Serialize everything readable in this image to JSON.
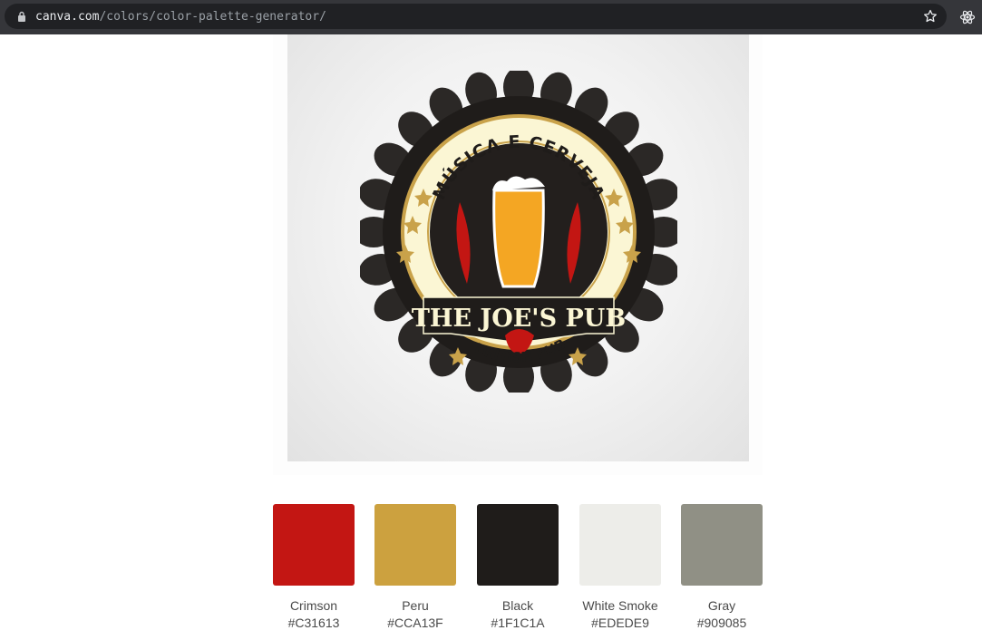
{
  "browser": {
    "url_domain": "canva.com",
    "url_path": "/colors/color-palette-generator/"
  },
  "icons": {
    "lock": "lock-icon",
    "bookmark": "star-icon",
    "extension": "atom-extension-icon"
  },
  "logo": {
    "top_text": "MÚSICA E CERVEJA",
    "title": "THE JOE'S PUB",
    "bottom_text": "BRITISH PUB"
  },
  "palette": [
    {
      "name": "Crimson",
      "hex": "#C31613"
    },
    {
      "name": "Peru",
      "hex": "#CCA13F"
    },
    {
      "name": "Black",
      "hex": "#1F1C1A"
    },
    {
      "name": "White Smoke",
      "hex": "#EDEDE9"
    },
    {
      "name": "Gray",
      "hex": "#909085"
    }
  ]
}
